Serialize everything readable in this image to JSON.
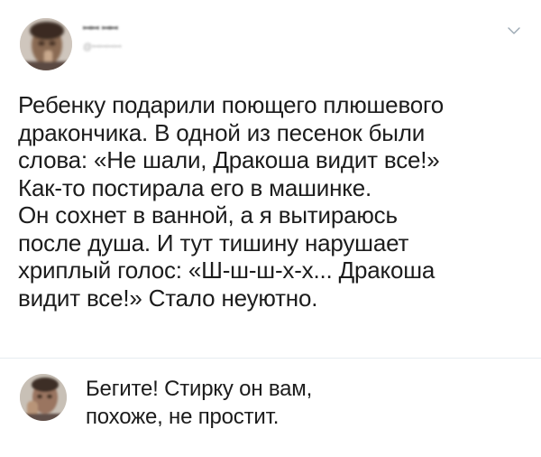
{
  "post": {
    "author": {
      "name": "ꟷꟷ ꟷꟷ",
      "handle": "@ꟷꟷꟷꟷ"
    },
    "text_lines": [
      "Ребенку подарили поющего плюшевого",
      "дракончика. В одной из песенок были",
      "слова: «Не шали, Дракоша видит все!»",
      "Как-то постирала его в машинке.",
      "Он сохнет в ванной, а я вытираюсь",
      "после душа. И тут тишину нарушает",
      "хриплый голос: «Ш-ш-ш-х-х... Дракоша",
      "видит все!» Стало неуютно."
    ],
    "menu_icon": "chevron-down-icon"
  },
  "reply": {
    "text_lines": [
      "Бегите! Стирку он вам,",
      "похоже, не простит."
    ]
  },
  "colors": {
    "text": "#1c1c1c",
    "handle": "#a8a8a8",
    "divider": "#e6ecf0",
    "chevron": "#9aa7b2"
  }
}
